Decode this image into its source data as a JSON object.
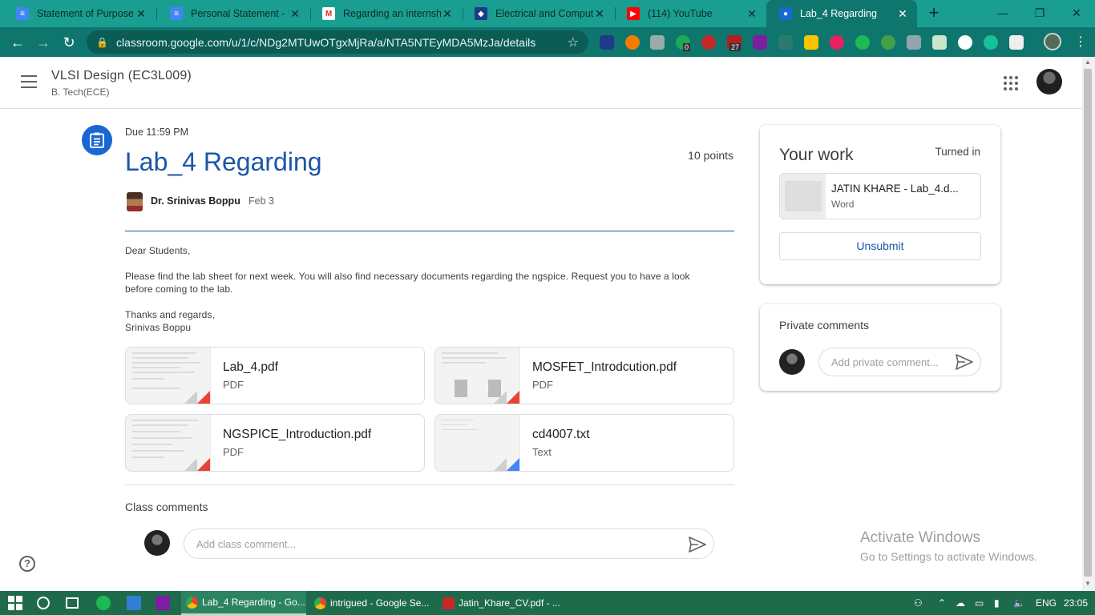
{
  "browser": {
    "tabs": [
      {
        "title": "Statement of Purpose - ",
        "icon": "docs-icon",
        "color": "#4285f4"
      },
      {
        "title": "Personal Statement - U",
        "icon": "docs-icon",
        "color": "#4285f4"
      },
      {
        "title": "Regarding an internship",
        "icon": "gmail-icon",
        "color": "#d93025"
      },
      {
        "title": "Electrical and Computer",
        "icon": "shield-icon",
        "color": "#1a3a8a"
      },
      {
        "title": "(114) YouTube",
        "icon": "youtube-icon",
        "color": "#ff0000"
      },
      {
        "title": "Lab_4 Regarding",
        "icon": "classroom-icon",
        "color": "#1967d2"
      }
    ],
    "url": "classroom.google.com/u/1/c/NDg2MTUwOTgxMjRa/a/NTA5NTEyMDA5MzJa/details",
    "extension_badges": [
      "0",
      "27"
    ]
  },
  "header": {
    "course_title": "VLSI Design (EC3L009)",
    "course_section": "B. Tech(ECE)"
  },
  "assignment": {
    "due": "Due 11:59 PM",
    "title": "Lab_4 Regarding",
    "points": "10 points",
    "teacher": "Dr. Srinivas Boppu",
    "date": "Feb 3",
    "body": [
      "Dear Students,",
      "Please find the lab sheet for next week. You will also find necessary documents regarding the ngspice. Request you to have a look before coming to the lab.",
      "Thanks and regards,",
      "Srinivas Boppu"
    ],
    "attachments": [
      {
        "name": "Lab_4.pdf",
        "type": "PDF"
      },
      {
        "name": "MOSFET_Introdcution.pdf",
        "type": "PDF"
      },
      {
        "name": "NGSPICE_Introduction.pdf",
        "type": "PDF"
      },
      {
        "name": "cd4007.txt",
        "type": "Text"
      }
    ]
  },
  "class_comments": {
    "heading": "Class comments",
    "placeholder": "Add class comment..."
  },
  "your_work": {
    "title": "Your work",
    "status": "Turned in",
    "file_name": "JATIN KHARE - Lab_4.d...",
    "file_type": "Word",
    "unsubmit_label": "Unsubmit"
  },
  "private_comments": {
    "title": "Private comments",
    "placeholder": "Add private comment..."
  },
  "watermark": {
    "line1": "Activate Windows",
    "line2": "Go to Settings to activate Windows."
  },
  "taskbar": {
    "apps": [
      {
        "label": "Lab_4 Regarding - Go..."
      },
      {
        "label": "intrigued - Google Se..."
      },
      {
        "label": "Jatin_Khare_CV.pdf - ..."
      }
    ],
    "language": "ENG",
    "time": "23:05"
  },
  "colors": {
    "chrome_frame": "#0f766e",
    "classroom_blue": "#1967d2",
    "title_blue": "#1a56a8",
    "taskbar": "#1e6b4b"
  }
}
